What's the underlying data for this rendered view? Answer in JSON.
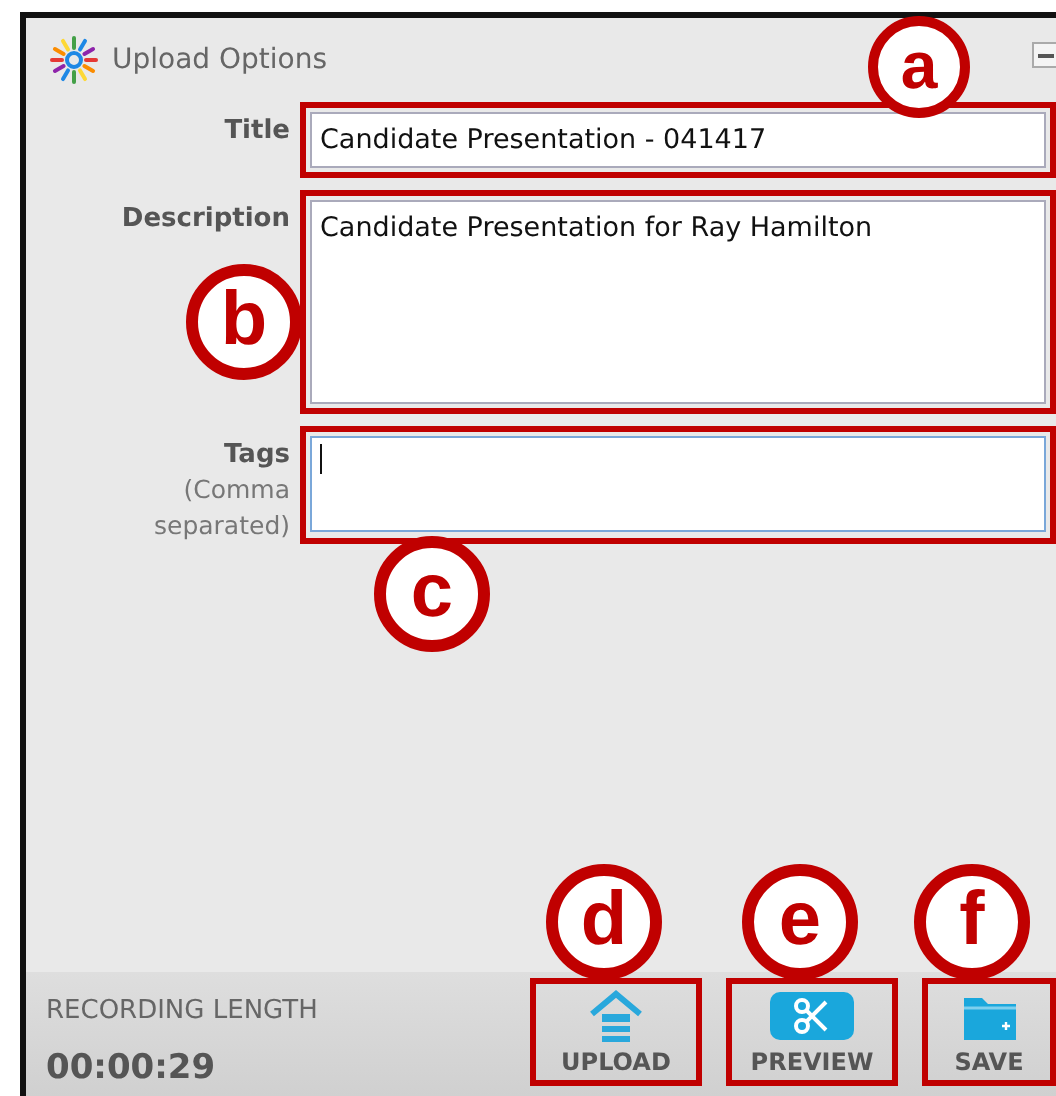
{
  "window": {
    "title": "Upload Options"
  },
  "fields": [
    {
      "kind": "input",
      "label": "Title",
      "value": "Candidate Presentation - 041417",
      "focused": false,
      "callout": "a"
    },
    {
      "kind": "textarea",
      "label": "Description",
      "value": "Candidate Presentation for Ray Hamilton",
      "focused": false,
      "callout": "b"
    },
    {
      "kind": "textarea",
      "label": "Tags",
      "hint": "(Comma separated)",
      "focused": true,
      "callout": "c"
    }
  ],
  "footer": {
    "caption": "RECORDING LENGTH",
    "duration": "00:00:29"
  },
  "buttons": [
    {
      "kind": "upload",
      "label": "UPLOAD",
      "callout": "d"
    },
    {
      "kind": "preview",
      "label": "PREVIEW",
      "callout": "e"
    },
    {
      "kind": "save",
      "label": "SAVE",
      "callout": "f"
    }
  ]
}
